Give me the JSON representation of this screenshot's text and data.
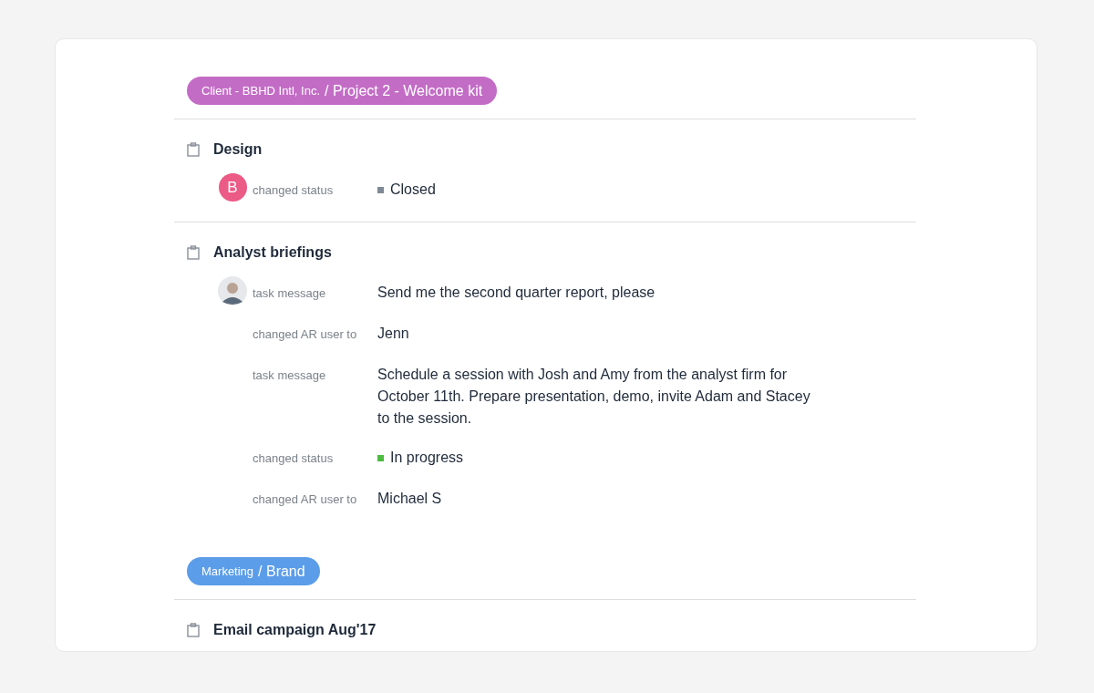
{
  "groups": [
    {
      "client": "Client - BBHD Intl, Inc.",
      "project": "/ Project 2 - Welcome kit",
      "color": "#c36cc6",
      "tasks": [
        {
          "title": "Design",
          "entries": [
            {
              "avatar": {
                "kind": "letter",
                "initial": "B"
              },
              "label": "changed status",
              "kind": "status",
              "value": "Closed",
              "color": "#7d8a96"
            }
          ]
        },
        {
          "title": "Analyst briefings",
          "entries": [
            {
              "avatar": {
                "kind": "photo"
              },
              "label": "task message",
              "kind": "text",
              "value": "Send me the second quarter report, please"
            },
            {
              "label": "changed AR user to",
              "kind": "text",
              "value": "Jenn"
            },
            {
              "label": "task message",
              "kind": "text",
              "value": "Schedule a session with Josh and Amy from the analyst firm for October 11th. Prepare presentation, demo, invite Adam and Stacey to the session."
            },
            {
              "label": "changed status",
              "kind": "status",
              "value": "In progress",
              "color": "#4cbb3f"
            },
            {
              "label": "changed AR user to",
              "kind": "text",
              "value": "Michael S"
            }
          ]
        }
      ]
    },
    {
      "client": "Marketing",
      "project": "/ Brand",
      "color": "#5b9de9",
      "tasks": [
        {
          "title": "Email campaign Aug'17"
        }
      ]
    }
  ]
}
